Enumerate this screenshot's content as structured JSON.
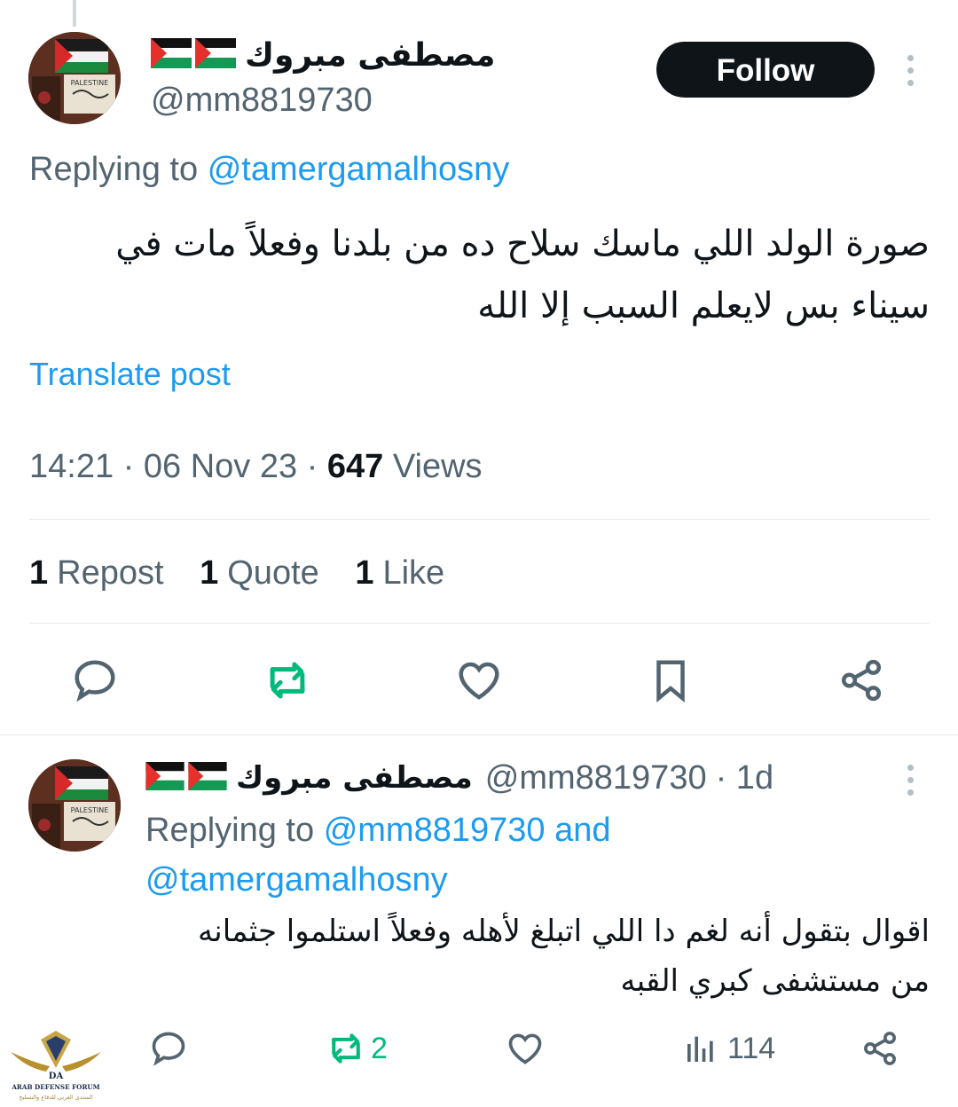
{
  "main_tweet": {
    "display_name": "مصطفى مبروك",
    "handle": "@mm8819730",
    "follow_label": "Follow",
    "reply_prefix": "Replying to",
    "reply_to": "@tamergamalhosny",
    "text_line1": "صورة الولد اللي ماسك سلاح ده من بلدنا وفعلاً مات في",
    "text_line2": "سيناء بس لايعلم السبب إلا الله",
    "translate_label": "Translate post",
    "time": "14:21",
    "date": "06 Nov 23",
    "views_count": "647",
    "views_label": "Views",
    "reposts_count": "1",
    "reposts_label": "Repost",
    "quotes_count": "1",
    "quotes_label": "Quote",
    "likes_count": "1",
    "likes_label": "Like",
    "avatar_text": "PALESTINE"
  },
  "reply_tweet": {
    "display_name": "مصطفى مبروك",
    "handle": "@mm8819730",
    "age": "· 1d",
    "reply_prefix": "Replying to",
    "reply_to_1": "@mm8819730",
    "reply_and": "and",
    "reply_to_2": "@tamergamalhosny",
    "text_line1": "اقوال بتقول أنه لغم دا اللي اتبلغ لأهله وفعلاً استلموا جثمانه",
    "text_line2": "من مستشفى كبري القبه",
    "retweet_count": "2",
    "views_count": "114",
    "avatar_text": "PALESTINE"
  },
  "watermark": {
    "line1": "ARAB DEFENSE FORUM",
    "line2": "المنتدى العربي للدفاع والتسليح",
    "monogram": "DA"
  },
  "colors": {
    "text": "#0f1419",
    "secondary": "#536471",
    "link": "#1d9bf0",
    "retweet_green": "#00ba7c",
    "divider": "#e7e9ea",
    "follow_bg": "#0f1419"
  },
  "icons": [
    "reply-icon",
    "retweet-icon",
    "like-icon",
    "bookmark-icon",
    "share-icon",
    "views-icon",
    "more-icon",
    "palestine-flag-icon"
  ]
}
